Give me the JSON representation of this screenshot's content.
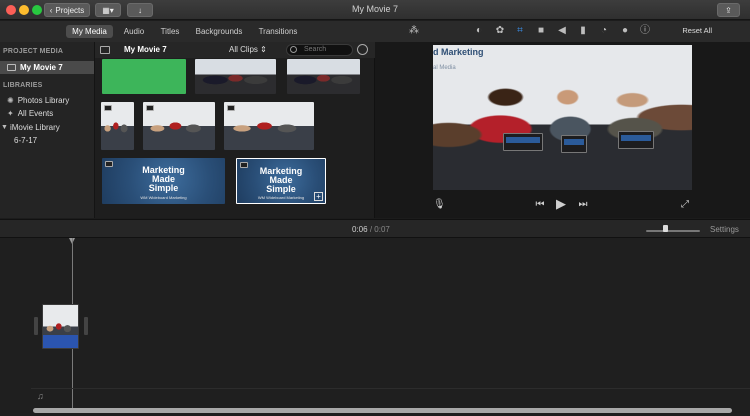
{
  "window": {
    "title": "My Movie 7",
    "back_button": "Projects"
  },
  "tabs": [
    "My Media",
    "Audio",
    "Titles",
    "Backgrounds",
    "Transitions"
  ],
  "active_tab": "My Media",
  "sidebar": {
    "project_media_heading": "PROJECT MEDIA",
    "project_item": "My Movie 7",
    "libraries_heading": "LIBRARIES",
    "items": [
      "Photos Library",
      "All Events",
      "iMovie Library",
      "6-7-17"
    ]
  },
  "browser": {
    "title": "My Movie 7",
    "filter": "All Clips",
    "search_placeholder": "Search",
    "brand_line1": "Marketing",
    "brand_line2": "Made",
    "brand_line3": "Simple",
    "brand_caption": "WM Wideboard Marketing"
  },
  "viewer": {
    "reset_label": "Reset All",
    "video_logo": "d Marketing",
    "video_sub": "al Media"
  },
  "timeline": {
    "current_time": "0:06",
    "separator": "/",
    "total_time": "0:07",
    "settings_label": "Settings",
    "zoom_level": 0.35
  },
  "icons": {
    "magic_wand": "magic-wand-icon",
    "color_balance": "color-balance-icon",
    "color_correction": "palette-icon",
    "crop": "crop-icon",
    "stabilization": "camera-icon",
    "volume": "speaker-icon",
    "equalizer": "equalizer-icon",
    "speed": "speedometer-icon",
    "noise": "filter-icon",
    "info": "info-icon"
  },
  "colors": {
    "accent": "#2b55b0",
    "traffic_red": "#fc5f57",
    "traffic_yellow": "#fdbc2e",
    "traffic_green": "#28c840"
  }
}
